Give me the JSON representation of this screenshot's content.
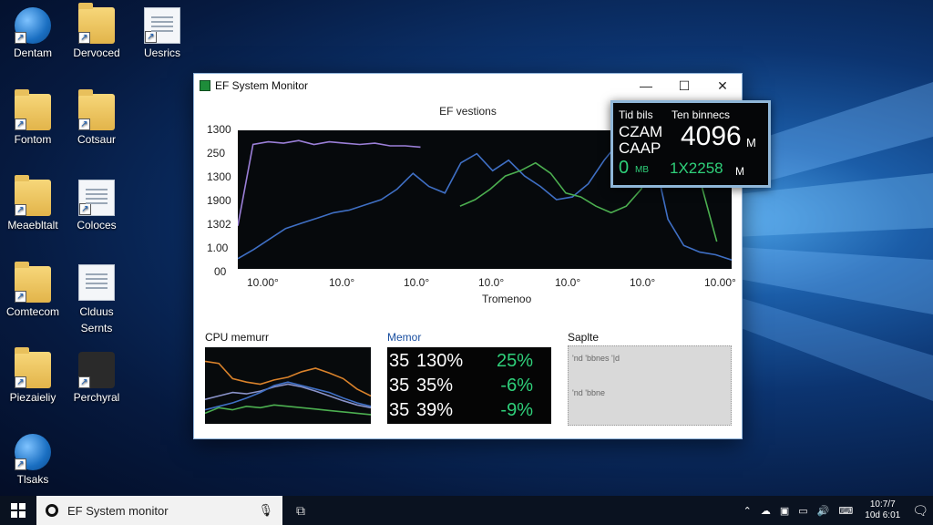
{
  "desktop_icons": [
    {
      "label": "Dentam",
      "icon": "globe"
    },
    {
      "label": "Dervoced",
      "icon": "folder"
    },
    {
      "label": "Uesrics",
      "icon": "document"
    },
    {
      "label": "Fontom",
      "icon": "folder"
    },
    {
      "label": "Cotsaur",
      "icon": "folder"
    },
    {
      "label": "Meaebltalt",
      "icon": "folder"
    },
    {
      "label": "Coloces",
      "icon": "document"
    },
    {
      "label": "Comtecom",
      "icon": "folder"
    },
    {
      "label": "Clduus Sernts",
      "icon": "document"
    },
    {
      "label": "Piezaieliy",
      "icon": "folder"
    },
    {
      "label": "Perchyral",
      "icon": "app"
    },
    {
      "label": "Tlsaks",
      "icon": "globe"
    }
  ],
  "window": {
    "title": "EF System Monitor",
    "minimize": "—",
    "maximize": "☐",
    "close": "✕"
  },
  "chart_data": [
    {
      "type": "line",
      "title": "EF vestions",
      "xlabel": "Tromenoo",
      "yticks": [
        "1300",
        "250",
        "1300",
        "1900",
        "1302",
        "1.00",
        "00"
      ],
      "xticks": [
        "10.00°",
        "10.0°",
        "10.0°",
        "10.0°",
        "10.0°",
        "10.0°",
        "10.00°"
      ],
      "series": [
        {
          "color": "#9b7fd8",
          "values": [
            0.3,
            0.92,
            0.94,
            0.93,
            0.95,
            0.92,
            0.94,
            0.93,
            0.92,
            0.93,
            0.91,
            0.91,
            0.9
          ]
        },
        {
          "color": "#3f6fc4",
          "values": [
            0.05,
            0.12,
            0.2,
            0.28,
            0.32,
            0.36,
            0.4,
            0.42,
            0.46,
            0.5,
            0.58,
            0.7,
            0.6,
            0.55,
            0.78,
            0.85,
            0.72,
            0.8,
            0.68,
            0.6,
            0.5,
            0.52,
            0.62,
            0.8,
            0.95,
            0.85,
            0.9,
            0.35,
            0.15,
            0.1,
            0.08,
            0.04
          ]
        },
        {
          "color": "#4caf50",
          "values": [
            0.45,
            0.5,
            0.58,
            0.68,
            0.72,
            0.78,
            0.7,
            0.55,
            0.52,
            0.45,
            0.4,
            0.45,
            0.58,
            0.85,
            0.92,
            0.98,
            0.6,
            0.18
          ]
        }
      ]
    },
    {
      "type": "line",
      "title": "CPU memurr",
      "series": [
        {
          "color": "#d9822b",
          "values": [
            0.85,
            0.82,
            0.6,
            0.55,
            0.52,
            0.58,
            0.62,
            0.7,
            0.75,
            0.68,
            0.6,
            0.45,
            0.35
          ]
        },
        {
          "color": "#8a93c9",
          "values": [
            0.3,
            0.35,
            0.4,
            0.38,
            0.42,
            0.48,
            0.52,
            0.48,
            0.42,
            0.35,
            0.28,
            0.22,
            0.18
          ]
        },
        {
          "color": "#3f6fc4",
          "values": [
            0.15,
            0.2,
            0.25,
            0.32,
            0.4,
            0.5,
            0.55,
            0.5,
            0.45,
            0.4,
            0.32,
            0.25,
            0.2
          ]
        },
        {
          "color": "#4caf50",
          "values": [
            0.1,
            0.18,
            0.15,
            0.2,
            0.18,
            0.22,
            0.2,
            0.18,
            0.16,
            0.14,
            0.12,
            0.1,
            0.08
          ]
        }
      ]
    }
  ],
  "memory": {
    "label": "Memor",
    "rows": [
      {
        "a": "35",
        "b": "130%",
        "c": "25%"
      },
      {
        "a": "35",
        "b": "35%",
        "c": "-6%"
      },
      {
        "a": "35",
        "b": "39%",
        "c": "-9%"
      }
    ]
  },
  "sample": {
    "label": "Saplte",
    "row1": "'nd 'bbnes '|d",
    "row2": "'nd 'bbne"
  },
  "overlay": {
    "h1": "Tid bils",
    "h2": "Ten binnecs",
    "l1": "CZAM",
    "l2": "CAAP",
    "big": "4096",
    "big_unit": "M",
    "g1": "0",
    "g1_unit": "MB",
    "g2": "1X2258",
    "g2_unit": "M"
  },
  "taskbar": {
    "search_text": "EF System monitor",
    "time": "10:7/7",
    "date": "10d 6:01"
  }
}
